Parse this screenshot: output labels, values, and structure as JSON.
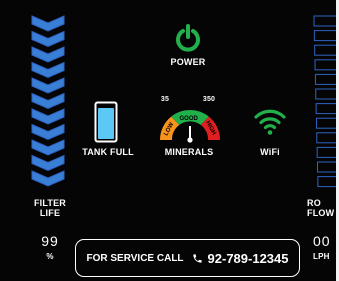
{
  "filter_life": {
    "label_line1": "FILTER",
    "label_line2": "LIFE",
    "value": "99",
    "unit": "%",
    "segment_count": 11,
    "level": 1.0
  },
  "power": {
    "label": "POWER",
    "icon": "power-icon",
    "color": "#22b04b"
  },
  "tank": {
    "label": "TANK FULL",
    "icon": "tank-icon",
    "fill_color": "#5bc8f5",
    "level": 0.85
  },
  "minerals": {
    "label": "MINERALS",
    "icon": "minerals-gauge-icon",
    "min_label": "35",
    "max_label": "350",
    "zones": [
      "LOW",
      "GOOD",
      "HIGH"
    ],
    "zone_colors": [
      "#f7941d",
      "#22b04b",
      "#e02020"
    ]
  },
  "wifi": {
    "label": "WiFi",
    "icon": "wifi-icon",
    "color": "#22b04b"
  },
  "ro_flow": {
    "label_line1": "RO",
    "label_line2": "FLOW",
    "value": "00",
    "unit": "LPH",
    "segment_count": 12,
    "level": 0.0
  },
  "service": {
    "text": "FOR SERVICE CALL",
    "phone": "92-789-12345",
    "icon": "phone-icon"
  },
  "colors": {
    "background": "#050505",
    "accent_blue": "#3a7fd6",
    "outline_blue": "#2f63c4",
    "text": "#ffffff"
  }
}
